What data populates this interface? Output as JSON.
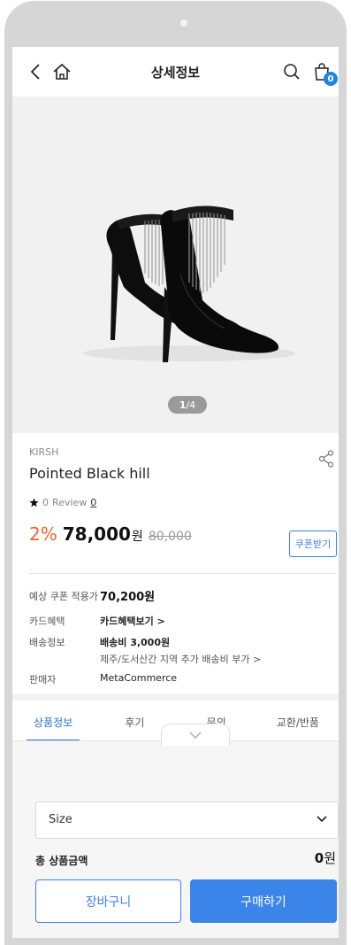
{
  "header": {
    "title": "상세정보",
    "cart_count": "0"
  },
  "gallery": {
    "pager_current": "1",
    "pager_total": "/4"
  },
  "product": {
    "brand": "KIRSH",
    "name": "Pointed Black hill",
    "rating": "0",
    "review_label": "Review",
    "review_count": "0",
    "discount": "2%",
    "price": "78,000",
    "price_unit": "원",
    "original_price": "80,000",
    "coupon_button": "쿠폰받기"
  },
  "info": {
    "coupon_label": "예상 쿠폰 적용가",
    "coupon_value": "70,200원",
    "card_label": "카드혜택",
    "card_value": "카드혜택보기 >",
    "shipping_label": "배송정보",
    "shipping_value": "배송비 3,000원",
    "shipping_sub": "제주/도서산간 지역 추가 배송비 부가 >",
    "seller_label": "판매자",
    "seller_value": "MetaCommerce"
  },
  "tabs": [
    "상품정보",
    "후기",
    "문의",
    "교환/반품"
  ],
  "purchase": {
    "option_value": "Size",
    "total_label": "총 상품금액",
    "total_value": "0",
    "total_unit": "원",
    "cart_button": "장바구니",
    "buy_button": "구매하기"
  },
  "colors": {
    "accent": "#3b85ea",
    "discount": "#f0622e",
    "badge": "#1e86e0"
  }
}
